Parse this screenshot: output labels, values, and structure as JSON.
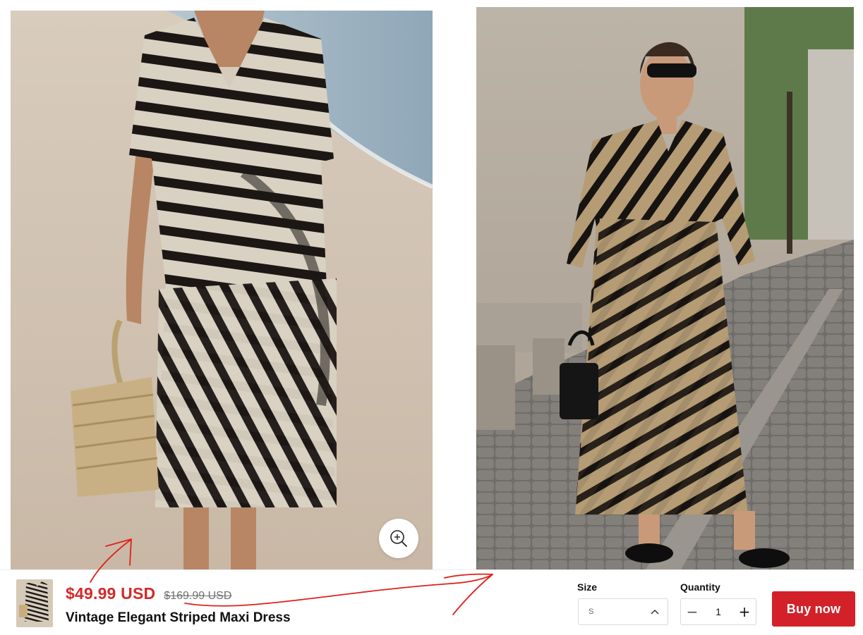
{
  "gallery": {
    "images": [
      {
        "alt": "Striped maxi dress on beach"
      },
      {
        "alt": "Striped maxi dress on street"
      }
    ],
    "zoom_icon": "zoom-in-icon"
  },
  "product": {
    "sale_price": "$49.99 USD",
    "compare_price": "$169.99 USD",
    "title": "Vintage Elegant Striped Maxi Dress"
  },
  "options": {
    "size_label": "Size",
    "size_value": "S",
    "size_icon": "chevron-up-icon",
    "quantity_label": "Quantity",
    "quantity_value": "1",
    "minus_glyph": "−",
    "plus_glyph": "+"
  },
  "actions": {
    "buy_label": "Buy now"
  },
  "colors": {
    "price_red": "#d32a2a",
    "buy_button": "#d3212a",
    "annotation_red": "#e0201b"
  }
}
